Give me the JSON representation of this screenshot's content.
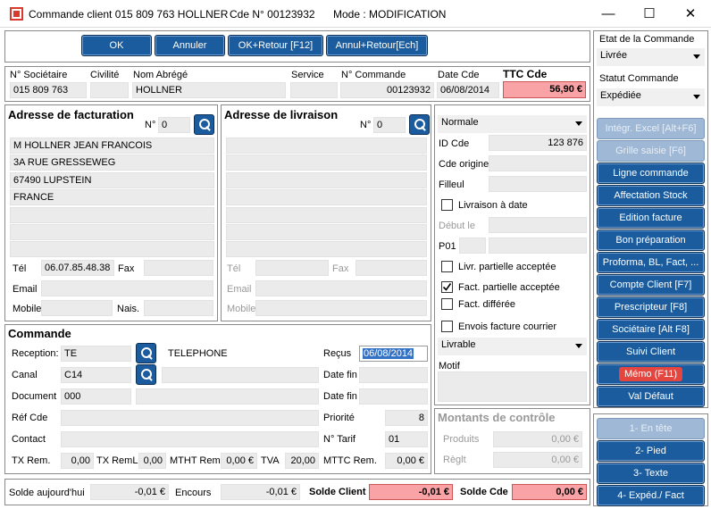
{
  "window": {
    "title": "Commande client 015 809 763 HOLLNER",
    "cde": "Cde N° 00123932",
    "mode": "Mode : MODIFICATION"
  },
  "toolbar": {
    "ok": "OK",
    "annuler": "Annuler",
    "ok_retour": "OK+Retour [F12]",
    "annul_retour": "Annul+Retour[Ech]"
  },
  "header": {
    "societaire_label": "N° Sociétaire",
    "societaire": "015 809 763",
    "civilite_label": "Civilité",
    "civilite": "",
    "nom_label": "Nom Abrégé",
    "nom": "HOLLNER",
    "service_label": "Service",
    "service": "",
    "ncde_label": "N° Commande",
    "ncde": "00123932",
    "datecde_label": "Date Cde",
    "datecde": "06/08/2014",
    "ttc_label": "TTC Cde",
    "ttc": "56,90 €"
  },
  "facturation": {
    "title": "Adresse de facturation",
    "no_label": "N°",
    "no": "0",
    "lines": [
      "M HOLLNER JEAN FRANCOIS",
      "3A RUE GRESSEWEG",
      "67490 LUPSTEIN",
      "FRANCE",
      "",
      "",
      ""
    ],
    "tel_label": "Tél",
    "tel": "06.07.85.48.38",
    "fax_label": "Fax",
    "fax": "",
    "email_label": "Email",
    "email": "",
    "mobile_label": "Mobile",
    "mobile": "",
    "nais_label": "Nais.",
    "nais": ""
  },
  "livraison": {
    "title": "Adresse de livraison",
    "no_label": "N°",
    "no": "0",
    "tel_label": "Tél",
    "fax_label": "Fax",
    "email_label": "Email",
    "mobile_label": "Mobile"
  },
  "commande": {
    "title": "Commande",
    "reception_label": "Reception:",
    "reception": "TE",
    "reception_desc": "TELEPHONE",
    "canal_label": "Canal",
    "canal": "C14",
    "document_label": "Document",
    "document": "000",
    "refcde_label": "Réf Cde",
    "contact_label": "Contact",
    "recus_label": "Reçus",
    "recus": "06/08/2014",
    "datefin1_label": "Date fin",
    "datefin2_label": "Date fin",
    "priorite_label": "Priorité",
    "priorite": "8",
    "tarif_label": "N° Tarif",
    "tarif": "01",
    "txrem_label": "TX Rem.",
    "txrem": "0,00",
    "txreml_label": "TX RemL",
    "txreml": "0,00",
    "mtht_label": "MTHT Rem.",
    "mtht": "0,00 €",
    "tva_label": "TVA",
    "tva": "20,00",
    "mttc_label": "MTTC Rem.",
    "mttc": "0,00 €"
  },
  "options": {
    "normale": "Normale",
    "idcde_label": "ID Cde",
    "idcde": "123 876",
    "origine_label": "Cde origine",
    "filleul_label": "Filleul",
    "livdate": "Livraison à date",
    "debut_label": "Début le",
    "p01_label": "P01",
    "livpart": "Livr. partielle acceptée",
    "factpart": "Fact. partielle acceptée",
    "factdiff": "Fact. différée",
    "envois": "Envois facture courrier",
    "livrable": "Livrable",
    "motif_label": "Motif"
  },
  "montants": {
    "title": "Montants de contrôle",
    "produits_label": "Produits",
    "produits": "0,00 €",
    "reglt_label": "Règlt",
    "reglt": "0,00 €"
  },
  "footer": {
    "solde_label": "Solde aujourd'hui",
    "solde": "-0,01 €",
    "encours_label": "Encours",
    "encours": "-0,01 €",
    "soldeclient_label": "Solde Client",
    "soldeclient": "-0,01 €",
    "soldecde_label": "Solde Cde",
    "soldecde": "0,00 €"
  },
  "side": {
    "etat_label": "Etat de la Commande",
    "etat": "Livrée",
    "statut_label": "Statut Commande",
    "statut": "Expédiée",
    "buttons": [
      "Intégr. Excel [Alt+F6]",
      "Grille saisie [F6]",
      "Ligne commande",
      "Affectation Stock",
      "Edition facture",
      "Bon préparation",
      "Proforma, BL, Fact, ...",
      "Compte Client [F7]",
      "Prescripteur [F8]",
      "Sociétaire [Alt F8]",
      "Suivi Client",
      "Mémo (F11)",
      "Val Défaut"
    ],
    "tabs": [
      "1- En tête",
      "2- Pied",
      "3- Texte",
      "4- Expéd./ Fact"
    ]
  }
}
